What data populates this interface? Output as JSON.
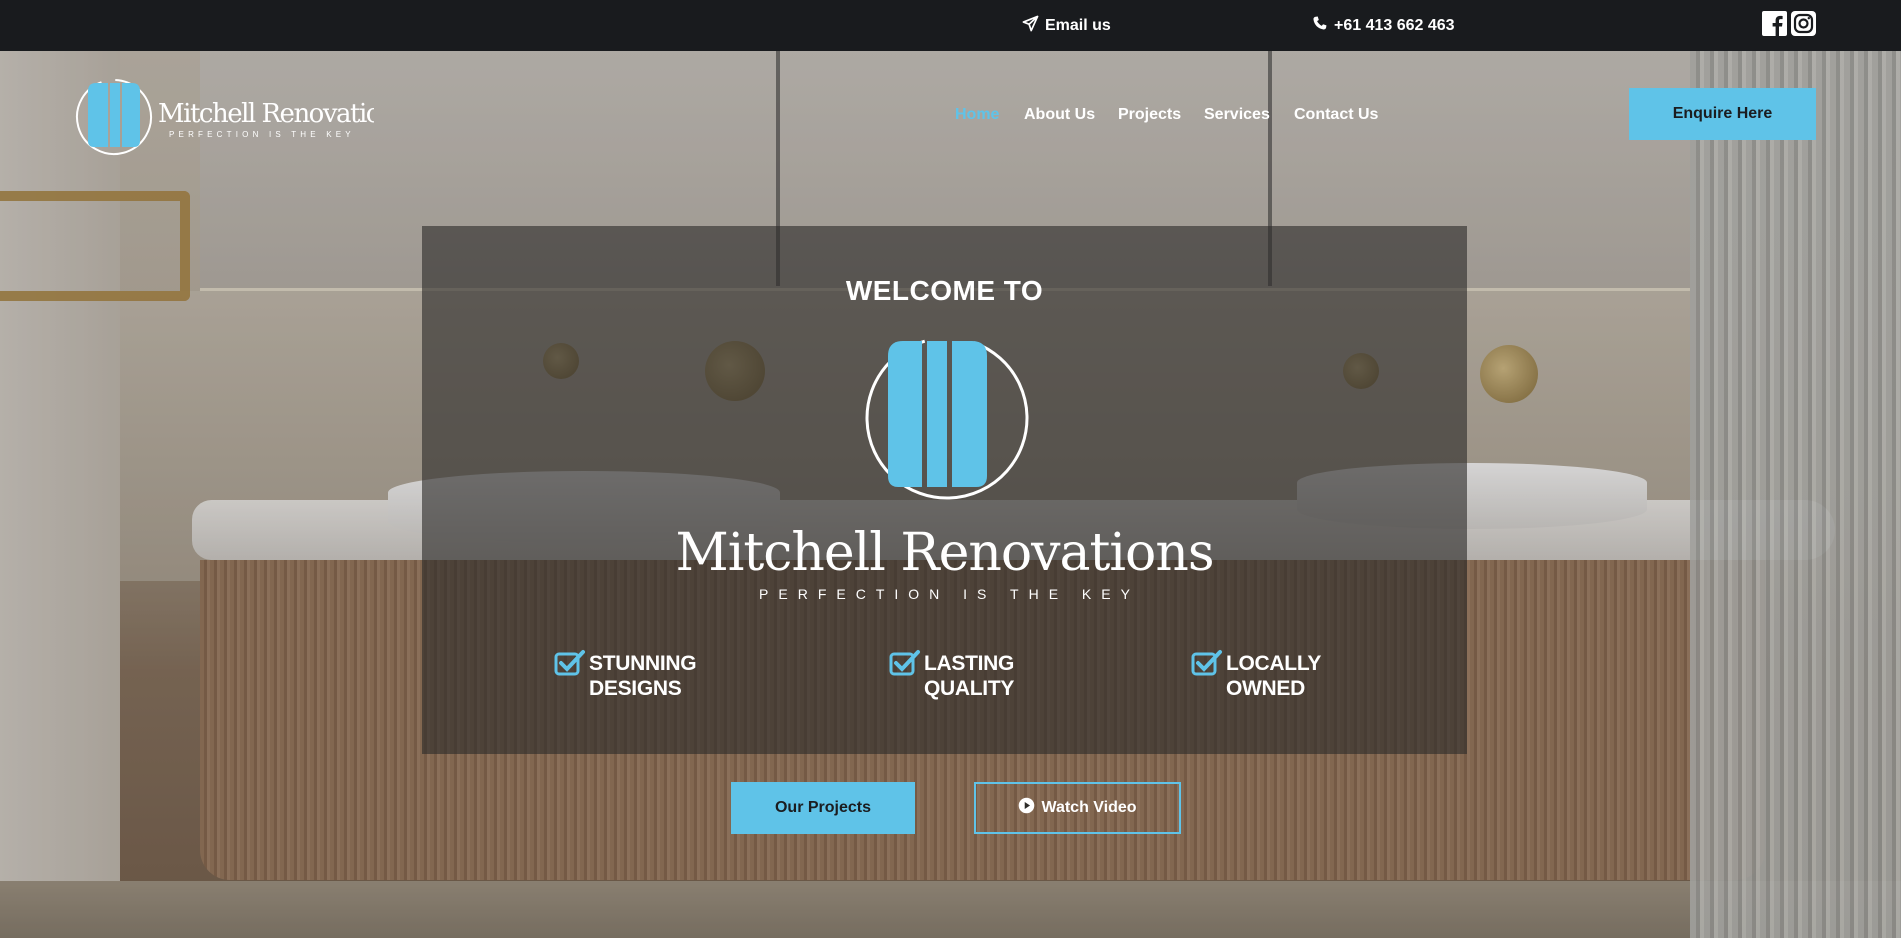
{
  "topbar": {
    "email_label": "Email us",
    "phone_label": "+61 413 662 463",
    "social": [
      "facebook-icon",
      "instagram-icon"
    ]
  },
  "brand": {
    "name": "Mitchell Renovations",
    "tagline": "PERFECTION IS THE KEY"
  },
  "nav": {
    "items": [
      {
        "label": "Home",
        "active": true
      },
      {
        "label": "About Us",
        "active": false
      },
      {
        "label": "Projects",
        "active": false
      },
      {
        "label": "Services",
        "active": false
      },
      {
        "label": "Contact Us",
        "active": false
      }
    ],
    "cta_label": "Enquire Here"
  },
  "hero": {
    "welcome": "WELCOME TO",
    "name": "Mitchell Renovations",
    "tagline": "PERFECTION IS THE KEY",
    "features": [
      {
        "line1": "STUNNING",
        "line2": "DESIGNS"
      },
      {
        "line1": "LASTING",
        "line2": "QUALITY"
      },
      {
        "line1": "LOCALLY",
        "line2": "OWNED"
      }
    ],
    "primary_button": "Our Projects",
    "secondary_button": "Watch Video"
  },
  "colors": {
    "accent": "#5fc3e8",
    "topbar": "#191b1e",
    "panel": "rgba(45,44,42,0.62)"
  }
}
